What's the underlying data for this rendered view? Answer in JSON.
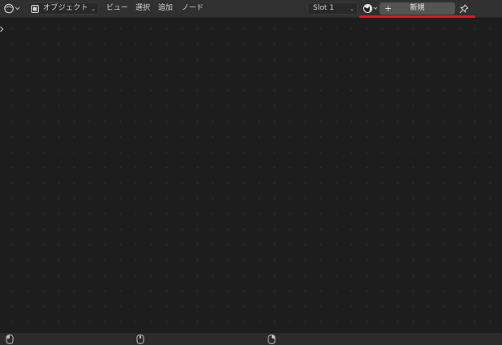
{
  "header": {
    "editor_type_icon": "node-editor-icon",
    "mode_label": "オブジェクト",
    "menus": [
      "ビュー",
      "選択",
      "追加",
      "ノード"
    ],
    "slot_label": "Slot 1",
    "new_label": "新規",
    "new_plus": "+",
    "browse_icon": "material-sphere-icon",
    "pin_icon": "pin-icon"
  },
  "colors": {
    "canvas_bg": "#1d1d1d",
    "header_bg": "#303030",
    "new_button_bg": "#545454",
    "highlight": "#e8141a"
  },
  "statusbar": {
    "icons": [
      "mouse-left-icon",
      "mouse-middle-icon",
      "mouse-right-icon"
    ]
  }
}
